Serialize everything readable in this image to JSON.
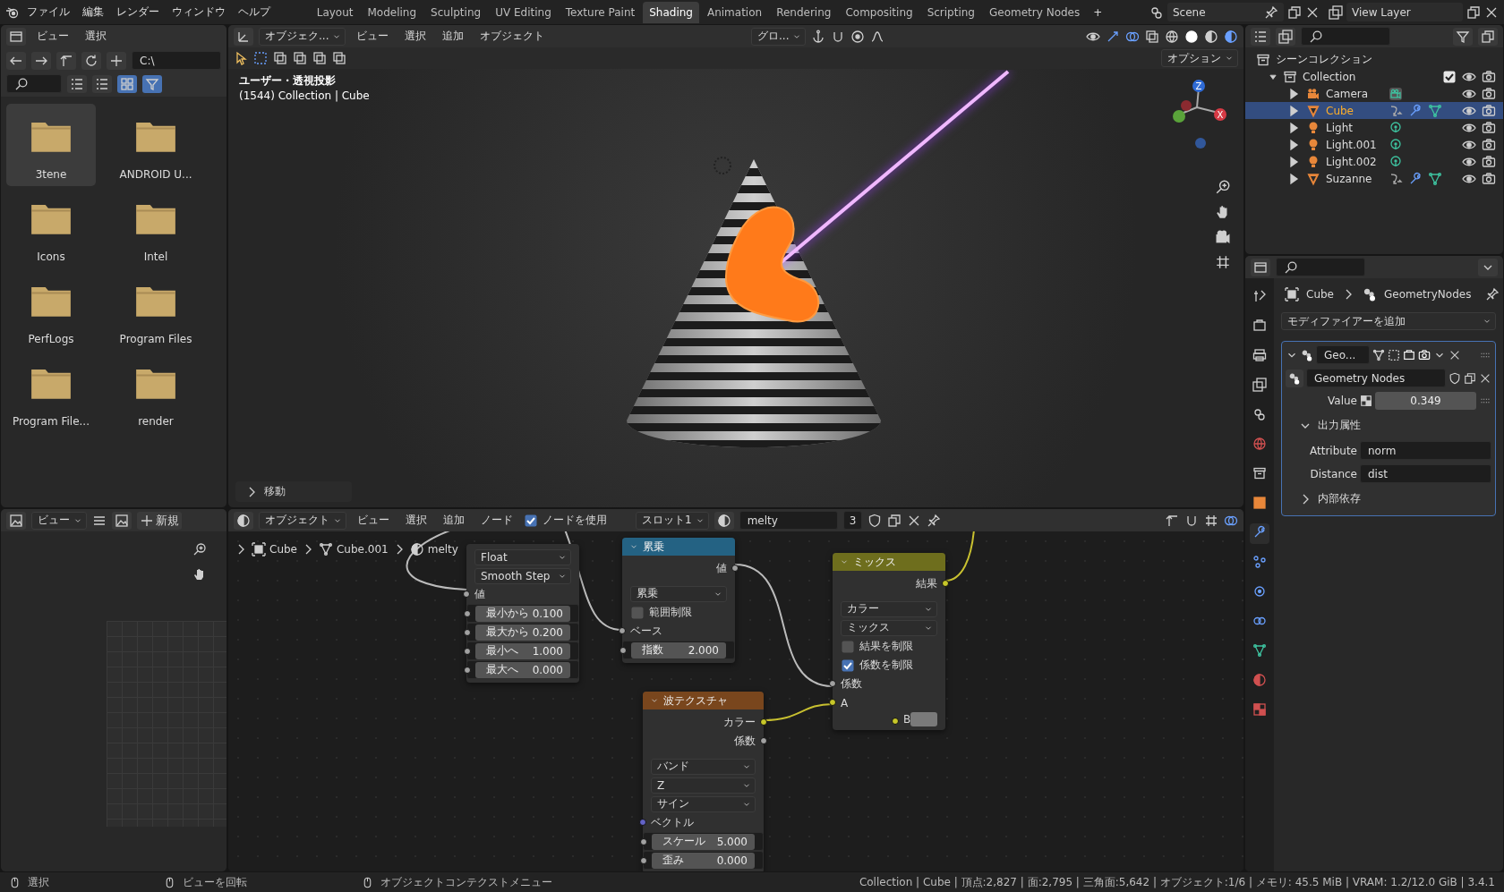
{
  "topbar": {
    "menus": [
      "ファイル",
      "編集",
      "レンダー",
      "ウィンドウ",
      "ヘルプ"
    ],
    "workspaces": [
      {
        "label": "Layout",
        "selected": false
      },
      {
        "label": "Modeling",
        "selected": false
      },
      {
        "label": "Sculpting",
        "selected": false
      },
      {
        "label": "UV Editing",
        "selected": false
      },
      {
        "label": "Texture Paint",
        "selected": false
      },
      {
        "label": "Shading",
        "selected": true
      },
      {
        "label": "Animation",
        "selected": false
      },
      {
        "label": "Rendering",
        "selected": false
      },
      {
        "label": "Compositing",
        "selected": false
      },
      {
        "label": "Scripting",
        "selected": false
      },
      {
        "label": "Geometry Nodes",
        "selected": false
      }
    ],
    "add_tab": "+",
    "scene": "Scene",
    "view_layer": "View Layer"
  },
  "file_browser": {
    "menus": [
      "ビュー",
      "選択"
    ],
    "path": "C:\\",
    "items": [
      {
        "name": "3tene",
        "selected": true
      },
      {
        "name": "ANDROID U...",
        "selected": false
      },
      {
        "name": "Icons",
        "selected": false
      },
      {
        "name": "Intel",
        "selected": false
      },
      {
        "name": "PerfLogs",
        "selected": false
      },
      {
        "name": "Program Files",
        "selected": false
      },
      {
        "name": "Program File...",
        "selected": false
      },
      {
        "name": "render",
        "selected": false
      }
    ]
  },
  "viewport": {
    "mode": "オブジェク...",
    "menus": [
      "ビュー",
      "選択",
      "追加",
      "オブジェクト"
    ],
    "orientation": "グロ...",
    "options": "オプション",
    "axis_labels": [
      "Z",
      "X"
    ],
    "info": [
      "ユーザー・透視投影",
      "(1544) Collection | Cube"
    ],
    "last_operation": "移動"
  },
  "outliner": {
    "root": "シーンコレクション",
    "collection": {
      "name": "Collection",
      "expanded": true,
      "checked": true
    },
    "items": [
      {
        "name": "Camera",
        "kind": "camera",
        "selected": false
      },
      {
        "name": "Cube",
        "kind": "mesh",
        "selected": true
      },
      {
        "name": "Light",
        "kind": "light",
        "selected": false
      },
      {
        "name": "Light.001",
        "kind": "light",
        "selected": false
      },
      {
        "name": "Light.002",
        "kind": "light",
        "selected": false
      },
      {
        "name": "Suzanne",
        "kind": "mesh",
        "selected": false
      }
    ]
  },
  "properties": {
    "tabs": [
      {
        "selected": false
      },
      {
        "selected": false
      },
      {
        "selected": false
      },
      {
        "selected": false
      },
      {
        "selected": false
      },
      {
        "selected": false
      },
      {
        "selected": false
      },
      {
        "selected": false
      },
      {
        "selected": true
      },
      {
        "selected": false
      },
      {
        "selected": false
      },
      {
        "selected": false
      },
      {
        "selected": false
      },
      {
        "selected": false
      },
      {
        "selected": false
      }
    ],
    "breadcrumb": [
      "Cube",
      "GeometryNodes"
    ],
    "add_modifier": "モディファイアーを追加",
    "modifier": {
      "name": "Geo...",
      "expanded": true,
      "node_group": "Geometry Nodes",
      "value_label": "Value",
      "value": "0.349",
      "sections": [
        {
          "title": "出力属性",
          "expanded": true,
          "fields": [
            {
              "label": "Attribute",
              "value": "norm"
            },
            {
              "label": "Distance",
              "value": "dist"
            }
          ]
        },
        {
          "title": "内部依存",
          "expanded": false
        }
      ]
    }
  },
  "image_editor": {
    "view_menu": "ビュー",
    "new_button": "新規"
  },
  "node_editor": {
    "mode": "オブジェクト",
    "menus": [
      "ビュー",
      "選択",
      "追加",
      "ノード"
    ],
    "use_nodes": {
      "label": "ノードを使用",
      "checked": true
    },
    "slot": "スロット1",
    "material": "melty",
    "users": "3",
    "breadcrumb": [
      "Cube",
      "Cube.001",
      "melty"
    ],
    "nodes": [
      {
        "kind": "none",
        "rows": [
          {
            "kind": "dropdown",
            "value": "Float"
          },
          {
            "kind": "dropdown",
            "value": "Smooth Step"
          },
          {
            "kind": "input",
            "label": "値",
            "color": "#a1a1a1"
          },
          {
            "kind": "field",
            "label": "最小から",
            "value": "0.100",
            "color": "#a1a1a1"
          },
          {
            "kind": "field",
            "label": "最大から",
            "value": "0.200",
            "color": "#a1a1a1"
          },
          {
            "kind": "field",
            "label": "最小へ",
            "value": "1.000",
            "color": "#a1a1a1"
          },
          {
            "kind": "field",
            "label": "最大へ",
            "value": "0.000",
            "color": "#a1a1a1"
          }
        ]
      },
      {
        "kind": "converter",
        "title": "累乗",
        "rows": [
          {
            "kind": "output",
            "label": "値",
            "color": "#a1a1a1"
          },
          {
            "kind": "dropdown",
            "value": "累乗"
          },
          {
            "kind": "checkbox",
            "label": "範囲制限",
            "checked": false
          },
          {
            "kind": "input",
            "label": "ベース",
            "color": "#a1a1a1"
          },
          {
            "kind": "field",
            "label": "指数",
            "value": "2.000",
            "color": "#a1a1a1"
          }
        ]
      },
      {
        "kind": "color",
        "title": "ミックス",
        "rows": [
          {
            "kind": "output",
            "label": "結果",
            "color": "#c7c729"
          },
          {
            "kind": "dropdown",
            "value": "カラー"
          },
          {
            "kind": "dropdown",
            "value": "ミックス"
          },
          {
            "kind": "checkbox",
            "label": "結果を制限",
            "checked": false
          },
          {
            "kind": "checkbox",
            "label": "係数を制限",
            "checked": true
          },
          {
            "kind": "input",
            "label": "係数",
            "color": "#a1a1a1"
          },
          {
            "kind": "input",
            "label": "A",
            "color": "#c7c729"
          },
          {
            "kind": "swatch",
            "label": "B",
            "color": "#c7c729",
            "swatch": {
              "color": "#7a7a7a"
            }
          }
        ]
      },
      {
        "kind": "texture",
        "title": "波テクスチャ",
        "rows": [
          {
            "kind": "output",
            "label": "カラー",
            "color": "#c7c729"
          },
          {
            "kind": "output",
            "label": "係数",
            "color": "#a1a1a1"
          },
          {
            "kind": "dropdown",
            "value": "バンド"
          },
          {
            "kind": "dropdown",
            "value": "Z"
          },
          {
            "kind": "dropdown",
            "value": "サイン"
          },
          {
            "kind": "input",
            "label": "ベクトル",
            "color": "#6363c7"
          },
          {
            "kind": "field",
            "label": "スケール",
            "value": "5.000",
            "color": "#a1a1a1"
          },
          {
            "kind": "field",
            "label": "歪み",
            "value": "0.000",
            "color": "#a1a1a1"
          }
        ]
      }
    ]
  },
  "status_bar": {
    "hints": [
      "選択",
      "ビューを回転",
      "オブジェクトコンテクストメニュー"
    ],
    "stats": "Collection | Cube | 頂点:2,827 | 面:2,795 | 三角面:5,642 | オブジェクト:1/6 | メモリ: 45.5 MiB | VRAM: 1.2/12.0 GiB | 3.4.1"
  }
}
